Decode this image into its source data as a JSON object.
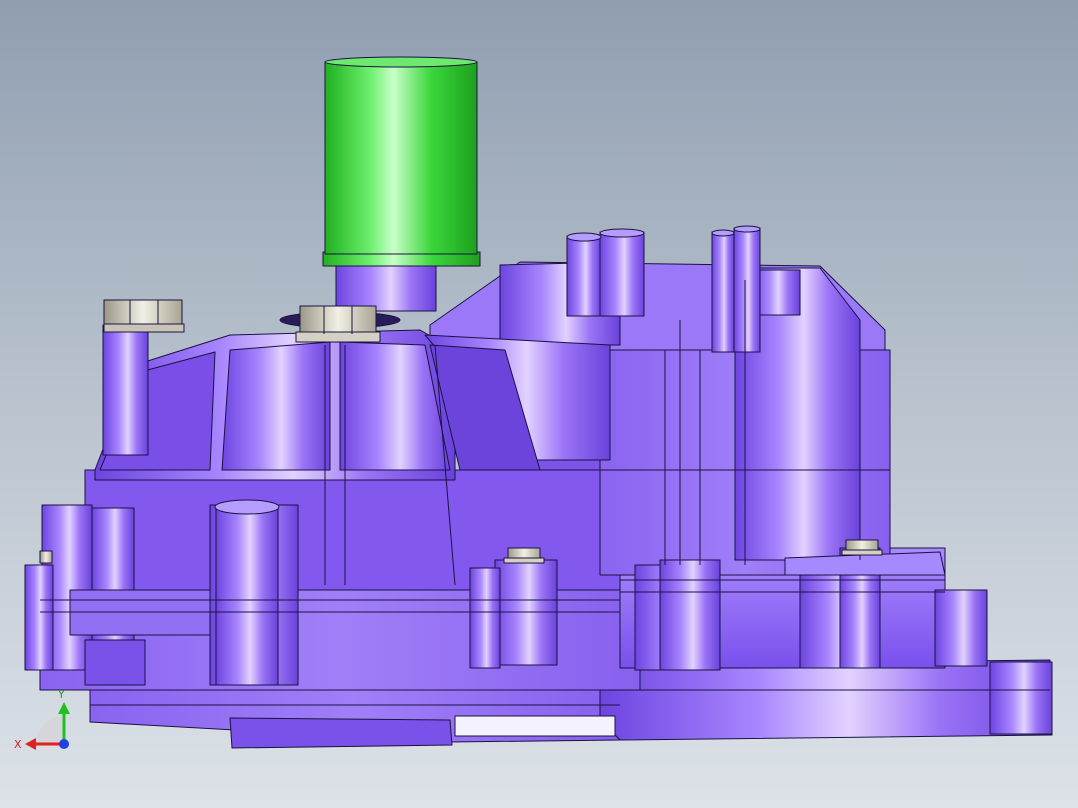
{
  "viewport": {
    "background_top": "#8f9eb0",
    "background_bottom": "#dde2e8"
  },
  "model": {
    "body_color": "#8a63f0",
    "highlight_color": "#d9c6ff",
    "edge_color": "#1a1240",
    "motor_color": "#2fd12f",
    "bolt_color": "#d8d4c8"
  },
  "triad": {
    "x_label": "X",
    "y_label": "Y",
    "x_color": "#e02020",
    "y_color": "#20c020",
    "z_color": "#2040e0"
  }
}
